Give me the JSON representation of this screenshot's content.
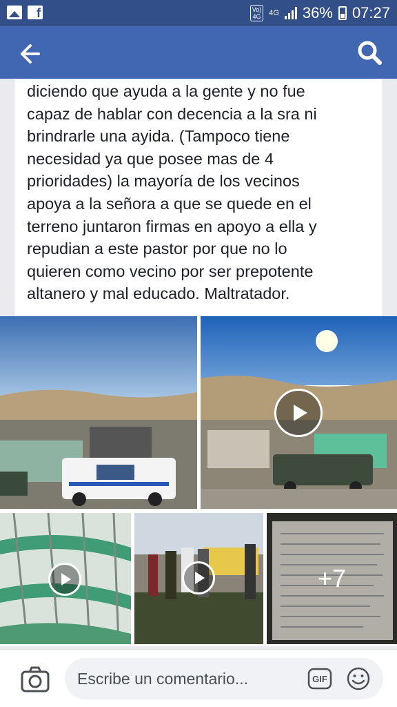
{
  "status_bar": {
    "network_badge": "Vo) 4G",
    "network_type": "4G",
    "battery": "36%",
    "time": "07:27"
  },
  "app_bar": {
    "back_icon": "arrow-left-icon",
    "search_icon": "search-icon"
  },
  "post": {
    "text": "diciendo que ayuda a la gente y no fue\ncapaz de hablar con decencia a la sra ni\nbrindrarle una ayida. (Tampoco tiene\nnecesidad ya que posee mas de 4\nprioridades)  la mayoría de los vecinos\napoya a la señora a que se quede en el\nterreno juntaron firmas en apoyo a ella y\nrepudian a este pastor por que no lo\nquieren  como vecino por ser prepotente\naltanero y mal educado. Maltratador."
  },
  "media": {
    "more_count": "+7"
  },
  "comment_bar": {
    "placeholder": "Escribe un comentario...",
    "gif_label": "GIF"
  },
  "colors": {
    "status_bar": "#324f89",
    "app_bar": "#4267b2",
    "text": "#1d2129"
  }
}
